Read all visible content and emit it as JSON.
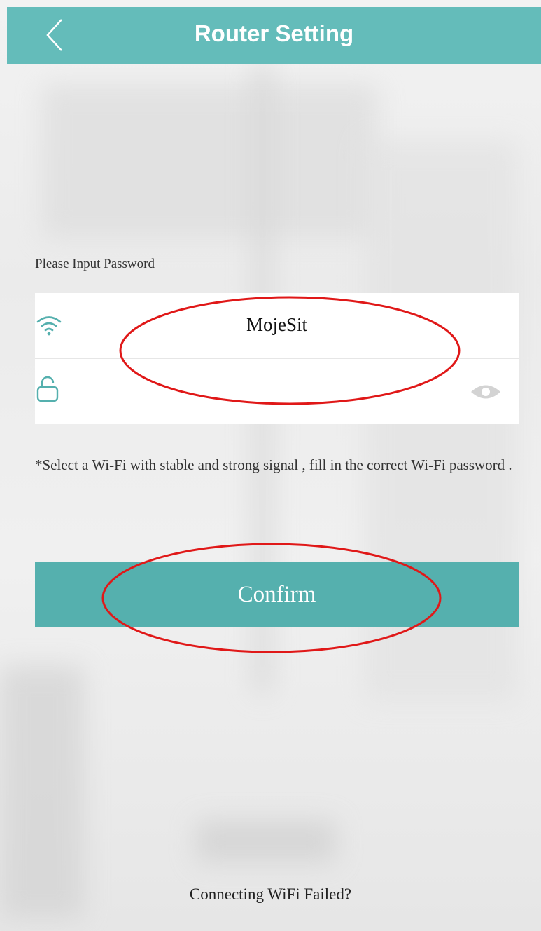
{
  "header": {
    "title": "Router Setting",
    "back_icon": "chevron-left-icon"
  },
  "form": {
    "prompt": "Please Input Password",
    "ssid": "MojeSit",
    "password_value": "",
    "icons": {
      "wifi": "wifi-icon",
      "lock": "lock-icon",
      "toggle": "eye-icon"
    }
  },
  "hint": "*Select a Wi-Fi with stable and strong signal , fill in the correct Wi-Fi password .",
  "confirm_label": "Confirm",
  "footer_link": "Connecting WiFi Failed?",
  "colors": {
    "accent": "#64bcba",
    "button": "#55b0ae",
    "annotation": "#e01818"
  }
}
